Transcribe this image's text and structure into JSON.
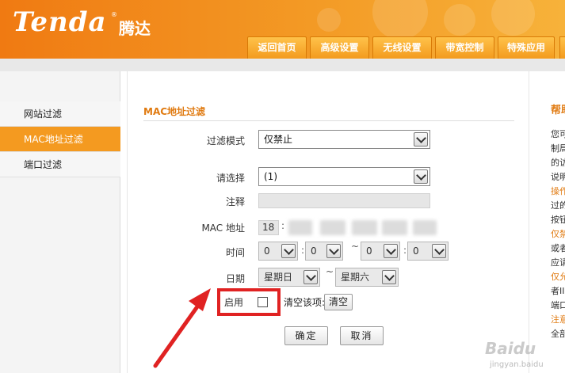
{
  "header": {
    "logo_text": "Tenda",
    "logo_reg": "®",
    "logo_cn": "腾达",
    "nav_tabs": [
      {
        "label": "返回首页"
      },
      {
        "label": "高级设置"
      },
      {
        "label": "无线设置"
      },
      {
        "label": "带宽控制"
      },
      {
        "label": "特殊应用"
      }
    ]
  },
  "sidebar": {
    "items": [
      {
        "label": "网站过滤",
        "active": false
      },
      {
        "label": "MAC地址过滤",
        "active": true
      },
      {
        "label": "端口过滤",
        "active": false
      }
    ]
  },
  "form": {
    "section_title": "MAC地址过滤",
    "filter_mode": {
      "label": "过滤模式",
      "value": "仅禁止"
    },
    "select_entry": {
      "label": "请选择",
      "value": "(1)"
    },
    "comment": {
      "label": "注释",
      "value": ""
    },
    "mac": {
      "label": "MAC 地址",
      "first_octet": "18",
      "separator": ":"
    },
    "time": {
      "label": "时间",
      "start_hour": "0",
      "start_min": "0",
      "end_hour": "0",
      "end_min": "0",
      "colon": ":",
      "range_sep": "~"
    },
    "date": {
      "label": "日期",
      "start": "星期日",
      "end": "星期六",
      "range_sep": "~"
    },
    "enable": {
      "label": "启用",
      "checked": false
    },
    "clear": {
      "label": "清空该项:",
      "button": "清空"
    },
    "confirm_button": "确定",
    "cancel_button": "取消"
  },
  "help": {
    "title": "帮助",
    "lines": [
      {
        "text": "您可",
        "color": "#333333"
      },
      {
        "text": "制局",
        "color": "#333333"
      },
      {
        "text": "的访",
        "color": "#333333"
      },
      {
        "text": "说明",
        "color": "#333333"
      },
      {
        "text": "操作",
        "color": "#e07a10"
      },
      {
        "text": "过的",
        "color": "#333333"
      },
      {
        "text": "按钮",
        "color": "#333333"
      },
      {
        "text": "仅禁",
        "color": "#e07a10"
      },
      {
        "text": "或者",
        "color": "#333333"
      },
      {
        "text": "应请",
        "color": "#333333"
      },
      {
        "text": "仅允",
        "color": "#e07a10"
      },
      {
        "text": "者II",
        "color": "#333333"
      },
      {
        "text": "端口",
        "color": "#333333"
      },
      {
        "text": "注意",
        "color": "#e07a10"
      },
      {
        "text": "全部",
        "color": "#333333"
      }
    ]
  },
  "watermark": {
    "text": "Baidu",
    "sub": "jingyan.baidu"
  }
}
